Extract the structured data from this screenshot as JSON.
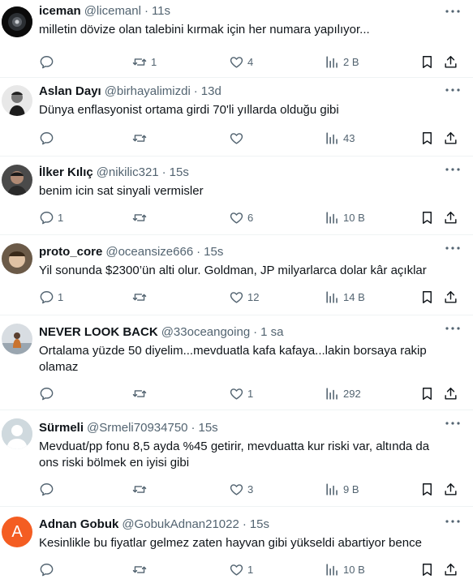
{
  "tweets": [
    {
      "name": "iceman",
      "handle": "@licemanl",
      "time": "11s",
      "text": "milletin dövize olan talebini kırmak için her numara yapılıyor...",
      "replies": "",
      "retweets": "1",
      "likes": "4",
      "views": "2 B"
    },
    {
      "name": "Aslan Dayı",
      "handle": "@birhayalimizdi",
      "time": "13d",
      "text": "Dünya enflasyonist ortama girdi 70'li yıllarda olduğu gibi",
      "replies": "",
      "retweets": "",
      "likes": "",
      "views": "43"
    },
    {
      "name": "İlker Kılıç",
      "handle": "@nikilic321",
      "time": "15s",
      "text": "benim icin sat sinyali vermisler",
      "replies": "1",
      "retweets": "",
      "likes": "6",
      "views": "10 B"
    },
    {
      "name": "proto_core",
      "handle": "@oceansize666",
      "time": "15s",
      "text": "Yil sonunda $2300’ün alti olur. Goldman, JP milyarlarca dolar kâr açıklar",
      "replies": "1",
      "retweets": "",
      "likes": "12",
      "views": "14 B"
    },
    {
      "name": "NEVER LOOK BACK",
      "handle": "@33oceangoing",
      "time": "1 sa",
      "text": "Ortalama yüzde 50 diyelim...mevduatla kafa kafaya...lakin borsaya rakip olamaz",
      "replies": "",
      "retweets": "",
      "likes": "1",
      "views": "292"
    },
    {
      "name": "Sürmeli",
      "handle": "@Srmeli70934750",
      "time": "15s",
      "text": "Mevduat/pp fonu 8,5 ayda %45 getirir, mevduatta kur riski var, altında da ons riski bölmek en iyisi gibi",
      "replies": "",
      "retweets": "",
      "likes": "3",
      "views": "9 B"
    },
    {
      "name": "Adnan Gobuk",
      "handle": "@GobukAdnan21022",
      "time": "15s",
      "avatar_letter": "A",
      "text": "Kesinlikle  bu fiyatlar gelmez  zaten hayvan gibi yükseldi  abartiyor bence",
      "replies": "",
      "retweets": "",
      "likes": "1",
      "views": "10 B"
    }
  ],
  "dot": "·",
  "colors": {
    "text": "#0f1419",
    "secondary": "#536471",
    "divider": "#eff3f4",
    "default_avatar": "#cfd9de",
    "letter_avatar": "#f45d22"
  },
  "icons": [
    "more-icon",
    "reply-icon",
    "retweet-icon",
    "like-icon",
    "views-icon",
    "bookmark-icon",
    "share-icon"
  ]
}
